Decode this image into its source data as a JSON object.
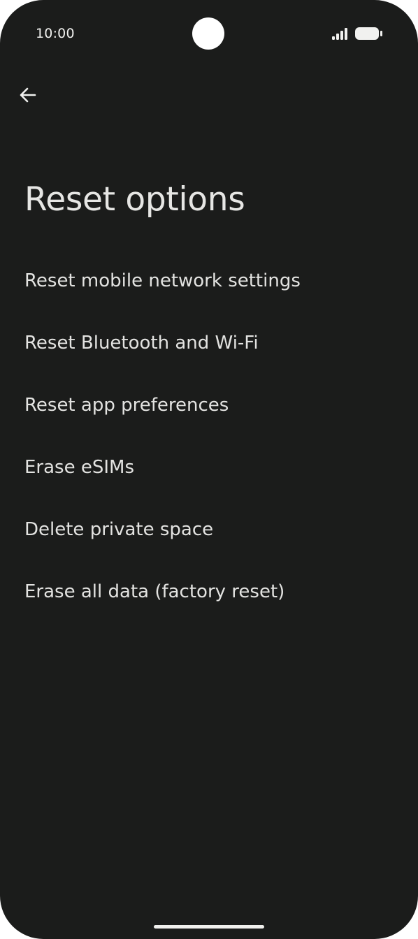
{
  "status_bar": {
    "time": "10:00",
    "icons": [
      "signal-icon",
      "battery-icon"
    ]
  },
  "toolbar": {
    "back_icon": "back-arrow-icon"
  },
  "page": {
    "title": "Reset options"
  },
  "options": [
    {
      "label": "Reset mobile network settings"
    },
    {
      "label": "Reset Bluetooth and Wi-Fi"
    },
    {
      "label": "Reset app preferences"
    },
    {
      "label": "Erase eSIMs"
    },
    {
      "label": "Delete private space"
    },
    {
      "label": "Erase all data (factory reset)"
    }
  ],
  "colors": {
    "background": "#1b1c1b",
    "text": "#e3e3e1"
  }
}
